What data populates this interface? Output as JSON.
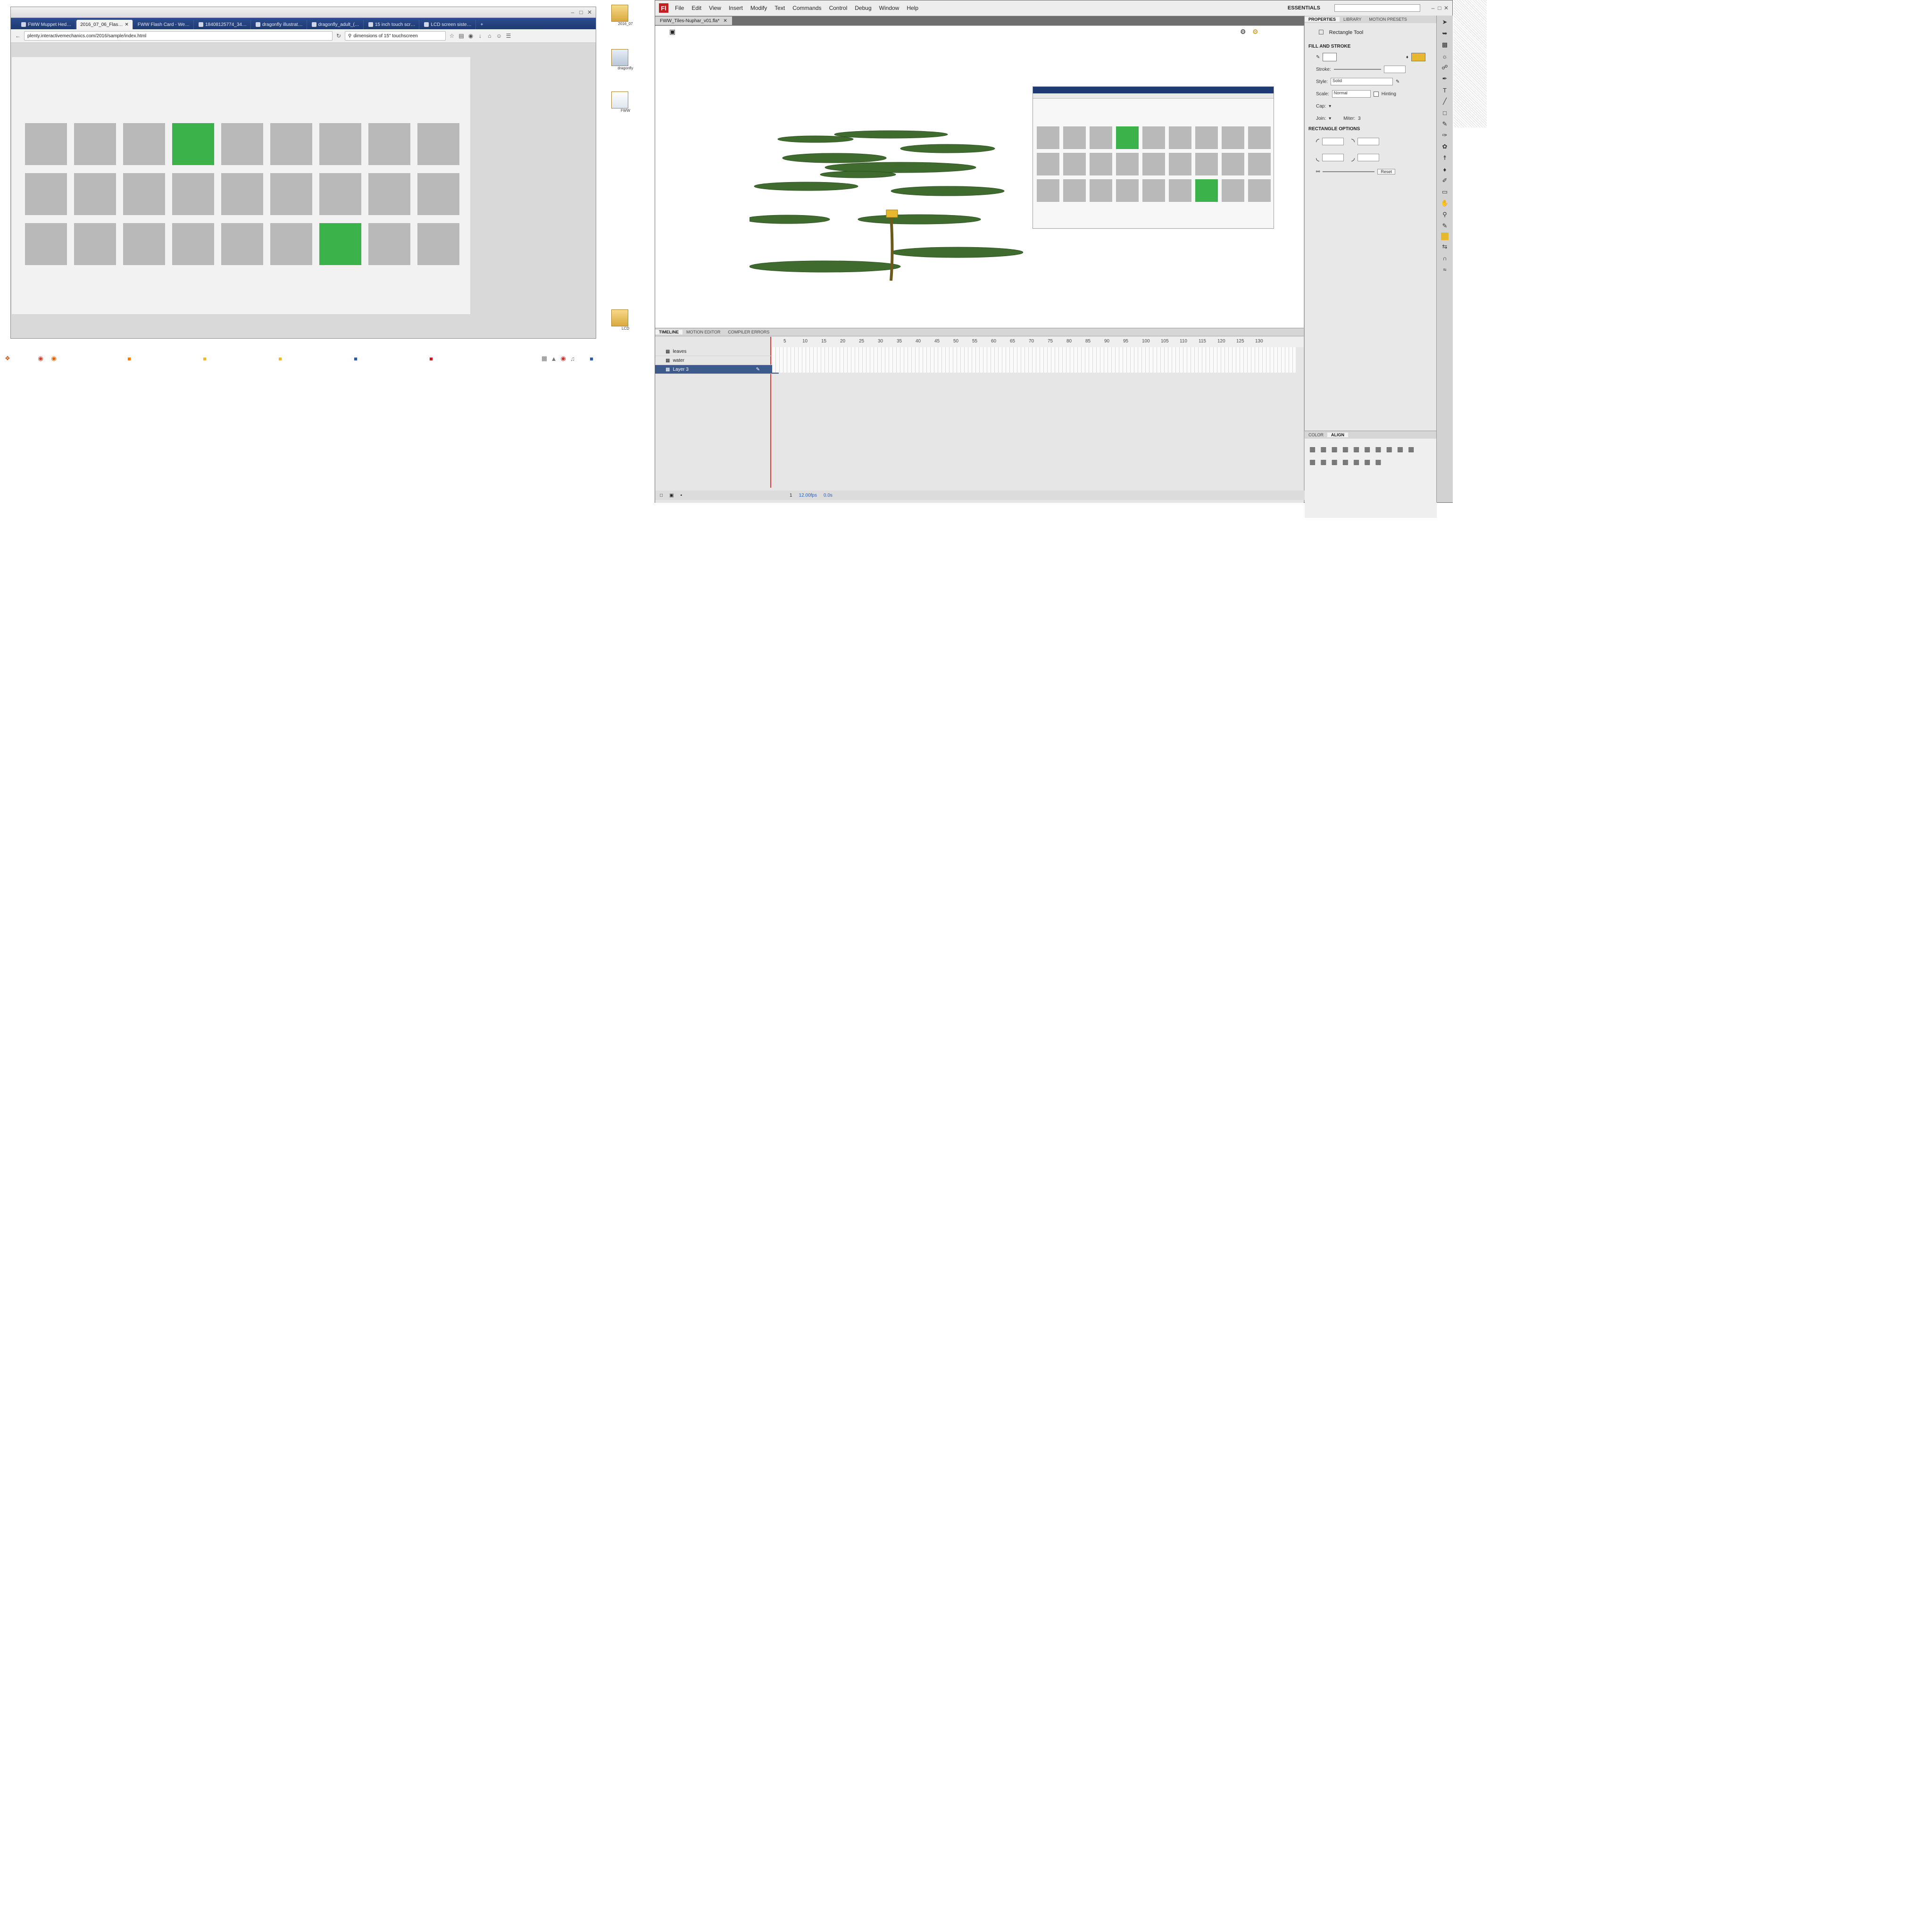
{
  "browser": {
    "tabs": [
      {
        "label": "FWW Muppet Hed…"
      },
      {
        "label": "2016_07_06_Flas…"
      },
      {
        "label": "FWW Flash Card - We…"
      },
      {
        "label": "18408125774_34…"
      },
      {
        "label": "dragonfly illustrat…"
      },
      {
        "label": "dragonfly_adult_(…"
      },
      {
        "label": "15 inch touch scr…"
      },
      {
        "label": "LCD screen siste…"
      }
    ],
    "new_tab_label": "+",
    "url": "plenty.interactivemechanics.com/2016/sample/index.html",
    "search_value": "dimensions of 15\" touchscreen",
    "grid": {
      "rows": 3,
      "cols": 9,
      "highlighted": [
        [
          0,
          3
        ],
        [
          2,
          6
        ]
      ],
      "tile_color": "#b9b9b9",
      "highlight_color": "#3bb34a"
    }
  },
  "desktop": {
    "icons": [
      {
        "label": "2016_07"
      },
      {
        "label": "dragonfly"
      },
      {
        "label": "FWW"
      },
      {
        "label": "LCD"
      }
    ]
  },
  "flash": {
    "menu": [
      "File",
      "Edit",
      "View",
      "Insert",
      "Modify",
      "Text",
      "Commands",
      "Control",
      "Debug",
      "Window",
      "Help"
    ],
    "workspace": "ESSENTIALS",
    "doc_tab": "FWW_Tiles-Nuphar_v01.fla*",
    "panel_tabs": [
      "TIMELINE",
      "MOTION EDITOR",
      "COMPILER ERRORS"
    ],
    "layers": [
      {
        "name": "leaves",
        "selected": false
      },
      {
        "name": "water",
        "selected": false
      },
      {
        "name": "Layer 3",
        "selected": true
      }
    ],
    "frame_numbers": [
      "5",
      "10",
      "15",
      "20",
      "25",
      "30",
      "35",
      "40",
      "45",
      "50",
      "55",
      "60",
      "65",
      "70",
      "75",
      "80",
      "85",
      "90",
      "95",
      "100",
      "105",
      "110",
      "115",
      "120",
      "125",
      "130"
    ],
    "timeline_status": {
      "frame": "1",
      "fps": "12.00fps",
      "time": "0.0s"
    },
    "properties": {
      "tabs": [
        "PROPERTIES",
        "LIBRARY",
        "MOTION PRESETS"
      ],
      "tool_name": "Rectangle Tool",
      "section_fill": "FILL AND STROKE",
      "fill_color": "#e6b82e",
      "stroke_label": "Stroke:",
      "style_label": "Style:",
      "style_value": "Solid",
      "scale_label": "Scale:",
      "scale_value": "Normal",
      "hinting_label": "Hinting",
      "cap_label": "Cap:",
      "join_label": "Join:",
      "miter_label": "Miter:",
      "miter_value": "3",
      "section_rect": "RECTANGLE OPTIONS",
      "reset_label": "Reset"
    },
    "align_tabs": [
      "COLOR",
      "ALIGN"
    ]
  }
}
